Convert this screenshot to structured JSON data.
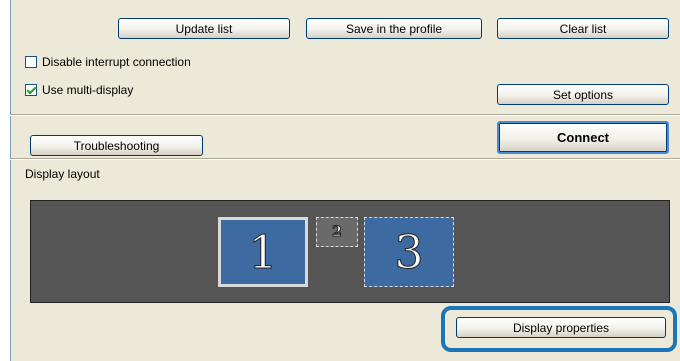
{
  "top_buttons": {
    "update_list": "Update list",
    "save_profile": "Save in the profile",
    "clear_list": "Clear list"
  },
  "options": {
    "disable_interrupt": {
      "label": "Disable interrupt connection",
      "checked": false
    },
    "multi_display": {
      "label": "Use multi-display",
      "checked": true
    }
  },
  "set_options_label": "Set options",
  "troubleshooting_label": "Troubleshooting",
  "connect_label": "Connect",
  "display_layout": {
    "heading": "Display layout",
    "monitors": [
      {
        "number": "1",
        "selected": true
      },
      {
        "number": "2",
        "selected": false
      },
      {
        "number": "3",
        "selected": false
      }
    ]
  },
  "display_properties_label": "Display properties",
  "colors": {
    "panel_bg": "#ece9d8",
    "layout_bg": "#555555",
    "monitor_blue": "#3d6aa0",
    "highlight_blue": "#1b75b8"
  }
}
